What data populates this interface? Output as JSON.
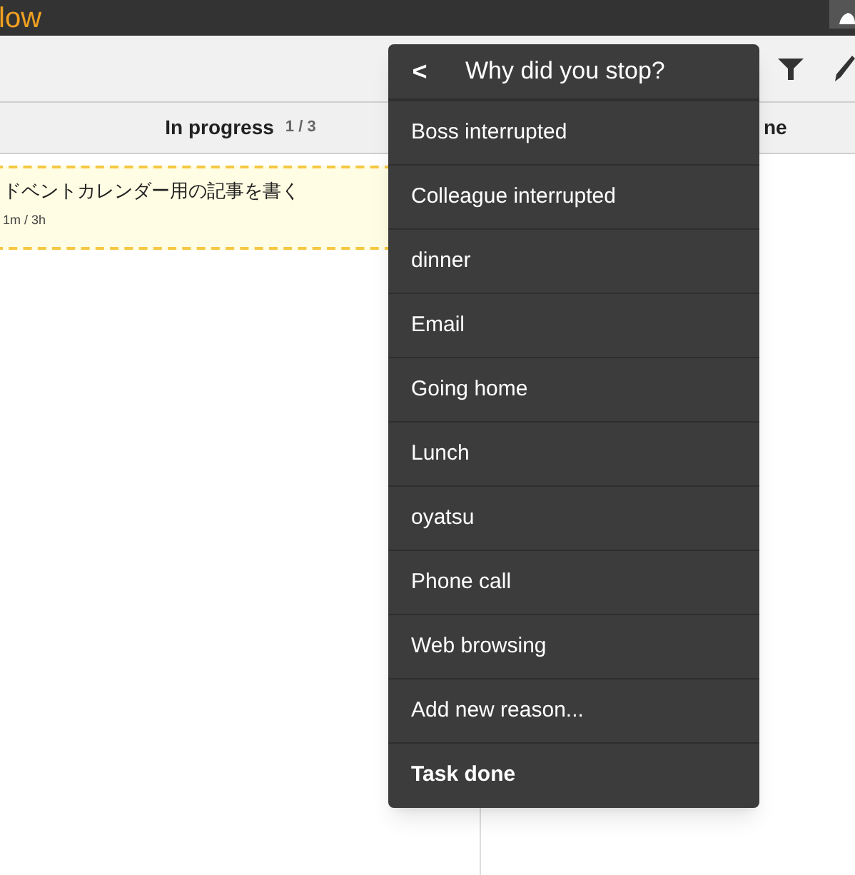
{
  "app": {
    "logo": "low"
  },
  "columns": [
    {
      "title": "In progress",
      "count": "1 / 3"
    },
    {
      "title": "ne"
    }
  ],
  "card": {
    "title": "ドベントカレンダー用の記事を書く",
    "time": "1m / 3h"
  },
  "menu": {
    "title": "Why did you stop?",
    "back": "<",
    "items": [
      {
        "label": "Boss interrupted",
        "kind": "reason"
      },
      {
        "label": "Colleague interrupted",
        "kind": "reason"
      },
      {
        "label": "dinner",
        "kind": "reason"
      },
      {
        "label": "Email",
        "kind": "reason"
      },
      {
        "label": "Going home",
        "kind": "reason"
      },
      {
        "label": "Lunch",
        "kind": "reason"
      },
      {
        "label": "oyatsu",
        "kind": "reason"
      },
      {
        "label": "Phone call",
        "kind": "reason"
      },
      {
        "label": "Web browsing",
        "kind": "reason"
      },
      {
        "label": "Add new reason...",
        "kind": "add"
      },
      {
        "label": "Task done",
        "kind": "done"
      }
    ]
  }
}
